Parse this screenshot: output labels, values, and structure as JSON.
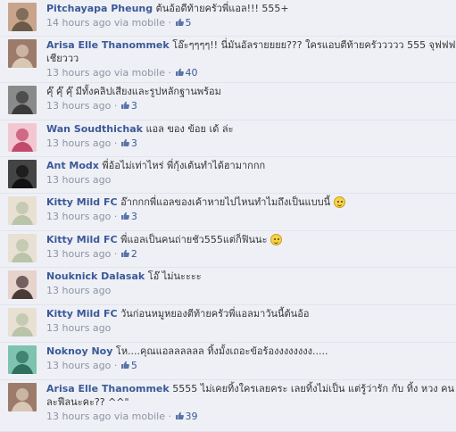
{
  "comments": [
    {
      "author": "Pitchayapa Pheung",
      "text": "ต้นอ้อดีท้ายครัวพี่แอล!!! 555+",
      "text2": "",
      "time": "14 hours ago",
      "via": "via mobile",
      "likes": "5",
      "avatar_colors": [
        "#6b5a4a",
        "#c8a58a"
      ],
      "emoji": false
    },
    {
      "author": "Arisa Elle Thanommek",
      "text": "โอ๊ะๆๆๆๆ!! นี่มันอัลรายยยย??? ใครแอบตีท้ายครัววววว 555 จุฟฟฟ ฟิน",
      "text2": "เชียววว",
      "time": "13 hours ago",
      "via": "via mobile",
      "likes": "40",
      "avatar_colors": [
        "#d9c7b5",
        "#9d7b6a"
      ],
      "emoji": false
    },
    {
      "author": "",
      "text": "คุ๊ คุ๊ คุ๊ มีทั้งคลิปเสียงและรูปหลักฐานพร้อม",
      "text2": "",
      "time": "13 hours ago",
      "via": "",
      "likes": "3",
      "avatar_colors": [
        "#3a3a3a",
        "#8a8a8a"
      ],
      "emoji": false
    },
    {
      "author": "Wan Soudthichak",
      "text": "แอล ของ ข้อย เด้ ล่ะ",
      "text2": "",
      "time": "13 hours ago",
      "via": "",
      "likes": "3",
      "avatar_colors": [
        "#c34a6c",
        "#f2c7d2"
      ],
      "emoji": false
    },
    {
      "author": "Ant Modx",
      "text": "พี่อ้อไม่เท่าไหร่ พี่กุ้งเต้นทำได้ฮามากกก",
      "text2": "",
      "time": "13 hours ago",
      "via": "",
      "likes": "",
      "avatar_colors": [
        "#111111",
        "#444444"
      ],
      "emoji": false
    },
    {
      "author": "Kitty Mild FC",
      "text": "อ๊ากกกพี่แอลของเค้าหายไปไหนทำไมถึงเป็นแบบนี้",
      "text2": "",
      "time": "13 hours ago",
      "via": "",
      "likes": "3",
      "avatar_colors": [
        "#b9c4a8",
        "#e8e0d2"
      ],
      "emoji": true
    },
    {
      "author": "Kitty Mild FC",
      "text": "พี่แอลเป็นคนถ่ายชัว555แต่ก็ฟินนะ",
      "text2": "",
      "time": "13 hours ago",
      "via": "",
      "likes": "2",
      "avatar_colors": [
        "#b9c4a8",
        "#e8e0d2"
      ],
      "emoji": true
    },
    {
      "author": "Nouknick Dalasak",
      "text": "โอ๊ ไม่นะะะะ",
      "text2": "",
      "time": "13 hours ago",
      "via": "",
      "likes": "",
      "avatar_colors": [
        "#4a3a38",
        "#e7d3cc"
      ],
      "emoji": false
    },
    {
      "author": "Kitty Mild FC",
      "text": "วันก่อนหมูหยองตีท้ายครัวพี่แอลมาวันนี้ต้นอ้อ",
      "text2": "",
      "time": "13 hours ago",
      "via": "",
      "likes": "",
      "avatar_colors": [
        "#b9c4a8",
        "#e8e0d2"
      ],
      "emoji": false
    },
    {
      "author": "Noknoy Noy",
      "text": "โห....คุณแอลลลลลล ทิ้งมั้งเถอะข้อร้องงงงงงงง.....",
      "text2": "",
      "time": "13 hours ago",
      "via": "",
      "likes": "5",
      "avatar_colors": [
        "#2f6f5e",
        "#7ec3b0"
      ],
      "emoji": false
    },
    {
      "author": "Arisa Elle Thanommek",
      "text": "5555 ไม่เคยทิ้งใครเลยคระ เลยทิ้งไม่เป็น แต่รู้ว่ารัก กับ ทิ้ง หวง คน",
      "text2": "ละฟีลนะคะ?? ^^\"",
      "time": "13 hours ago",
      "via": "via mobile",
      "likes": "39",
      "avatar_colors": [
        "#d9c7b5",
        "#9d7b6a"
      ],
      "emoji": false
    }
  ]
}
